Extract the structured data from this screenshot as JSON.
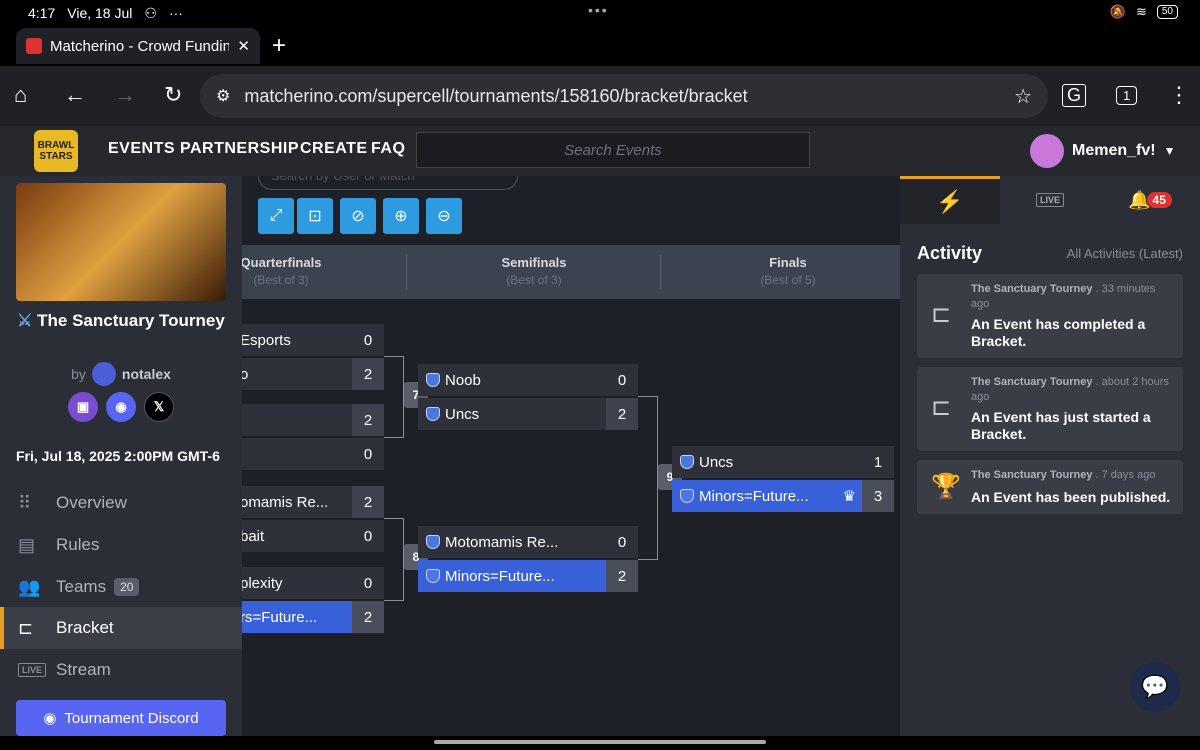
{
  "status": {
    "time": "4:17",
    "date": "Vie, 18 Jul",
    "dots": "•••",
    "battery": "50"
  },
  "browser": {
    "tab_title": "Matcherino - Crowd Fundin",
    "new_tab": "+",
    "url": "matcherino.com/supercell/tournaments/158160/bracket/bracket",
    "tab_count": "1"
  },
  "site": {
    "logo_text": "BRAWL STARS",
    "nav": [
      "EVENTS",
      "PARTNERSHIP",
      "CREATE",
      "FAQ"
    ],
    "search_placeholder": "Search Events",
    "username": "Memen_fv!"
  },
  "sidebar": {
    "title": "The Sanctuary Tourney",
    "by": "by",
    "author": "notalex",
    "date": "Fri, Jul 18, 2025 2:00PM GMT-6",
    "items": [
      {
        "label": "Overview",
        "icon": "grid-icon"
      },
      {
        "label": "Rules",
        "icon": "rules-icon"
      },
      {
        "label": "Teams",
        "icon": "teams-icon",
        "count": "20"
      },
      {
        "label": "Bracket",
        "icon": "bracket-icon"
      },
      {
        "label": "Stream",
        "icon": "live-icon"
      }
    ],
    "discord_button": "Tournament Discord"
  },
  "bracket": {
    "search_placeholder": "Search by User or Match",
    "rounds": [
      {
        "name": "Quarterfinals",
        "best_of": "(Best of 3)"
      },
      {
        "name": "Semifinals",
        "best_of": "(Best of 3)"
      },
      {
        "name": "Finals",
        "best_of": "(Best of 5)"
      }
    ],
    "qf": [
      {
        "team": "Esports",
        "score": "0"
      },
      {
        "team": "o",
        "score": "2"
      },
      {
        "team": "",
        "score": "2"
      },
      {
        "team": "",
        "score": "0"
      },
      {
        "team": "omamis Re...",
        "score": "2"
      },
      {
        "team": "bait",
        "score": "0"
      },
      {
        "team": "plexity",
        "score": "0"
      },
      {
        "team": "rs=Future...",
        "score": "2"
      }
    ],
    "sf": [
      {
        "team": "Noob",
        "score": "0"
      },
      {
        "team": "Uncs",
        "score": "2"
      },
      {
        "team": "Motomamis Re...",
        "score": "0"
      },
      {
        "team": "Minors=Future...",
        "score": "2"
      }
    ],
    "final": [
      {
        "team": "Uncs",
        "score": "1"
      },
      {
        "team": "Minors=Future...",
        "score": "3"
      }
    ],
    "match_numbers": [
      "7",
      "8",
      "9"
    ]
  },
  "activity": {
    "heading": "Activity",
    "all_link": "All Activities (Latest)",
    "notif_count": "45",
    "live_label": "LIVE",
    "items": [
      {
        "source": "The Sanctuary Tourney",
        "time": ". 33 minutes ago",
        "message": "An Event has completed a Bracket."
      },
      {
        "source": "The Sanctuary Tourney",
        "time": ". about 2 hours ago",
        "message": "An Event has just started a Bracket."
      },
      {
        "source": "The Sanctuary Tourney",
        "time": ". 7 days ago",
        "message": "An Event has been published."
      }
    ]
  },
  "colors": {
    "accent": "#e8a020",
    "winner": "#3860d8",
    "control": "#2e9be0",
    "discord": "#5865f2"
  }
}
